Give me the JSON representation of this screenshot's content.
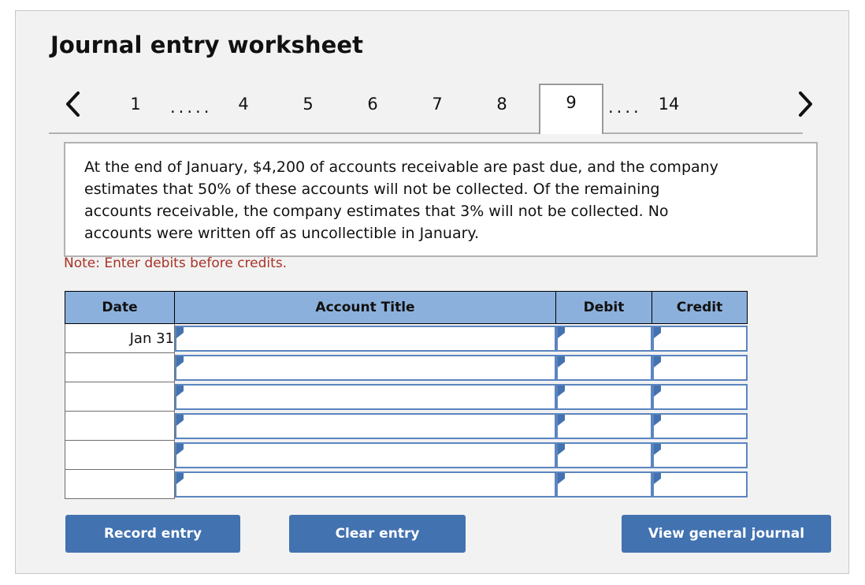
{
  "header": {
    "title": "Journal entry worksheet"
  },
  "tabs": {
    "prev_arrow": "chevron-left-icon",
    "next_arrow": "chevron-right-icon",
    "prev_label": "‹",
    "next_label": "›",
    "items": [
      {
        "label": "1",
        "active": false
      },
      {
        "label": ".....",
        "active": false,
        "ellipsis": true
      },
      {
        "label": "4",
        "active": false
      },
      {
        "label": "5",
        "active": false
      },
      {
        "label": "6",
        "active": false
      },
      {
        "label": "7",
        "active": false
      },
      {
        "label": "8",
        "active": false
      },
      {
        "label": "9",
        "active": true
      },
      {
        "label": "....",
        "active": false,
        "ellipsis": true
      },
      {
        "label": "14",
        "active": false
      }
    ],
    "active_tab": "9"
  },
  "description": {
    "text": "At the end of January, $4,200 of accounts receivable are past due, and the company estimates that 50% of these accounts will not be collected. Of the remaining accounts receivable, the company estimates that 3% will not be collected. No accounts were written off as uncollectible in January."
  },
  "note": {
    "text": "Note: Enter debits before credits.",
    "color": "#a93226"
  },
  "table": {
    "columns": [
      "Date",
      "Account Title",
      "Debit",
      "Credit"
    ],
    "rows": [
      {
        "date": "Jan 31",
        "account": "",
        "debit": "",
        "credit": ""
      },
      {
        "date": "",
        "account": "",
        "debit": "",
        "credit": ""
      },
      {
        "date": "",
        "account": "",
        "debit": "",
        "credit": ""
      },
      {
        "date": "",
        "account": "",
        "debit": "",
        "credit": ""
      },
      {
        "date": "",
        "account": "",
        "debit": "",
        "credit": ""
      },
      {
        "date": "",
        "account": "",
        "debit": "",
        "credit": ""
      }
    ],
    "header_color": "#8cb0dc",
    "input_border_color": "#5b85c0"
  },
  "buttons": {
    "record": "Record entry",
    "clear": "Clear entry",
    "view": "View general journal",
    "color": "#4272b0"
  }
}
